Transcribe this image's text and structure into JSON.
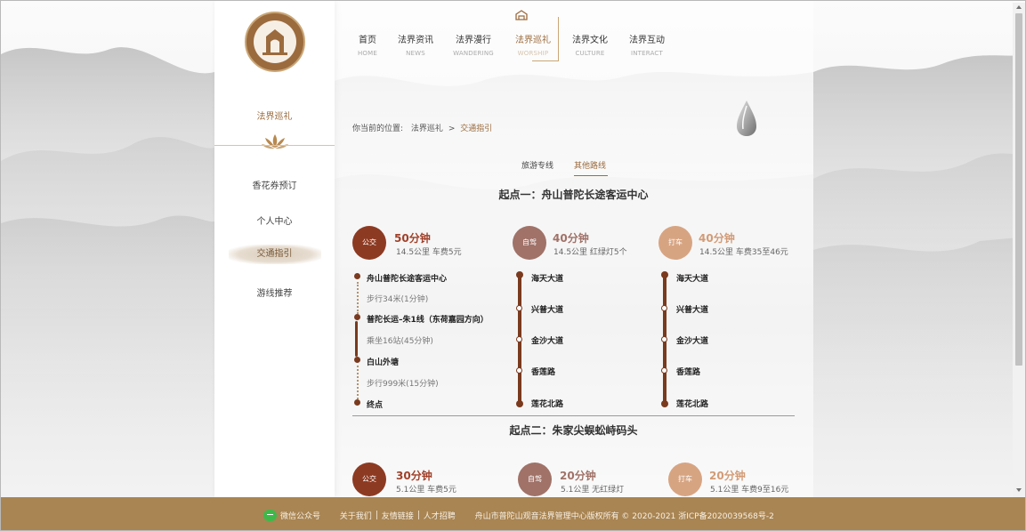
{
  "nav": [
    {
      "cn": "首页",
      "en": "HOME"
    },
    {
      "cn": "法界资讯",
      "en": "NEWS"
    },
    {
      "cn": "法界漫行",
      "en": "WANDERING"
    },
    {
      "cn": "法界巡礼",
      "en": "WORSHIP"
    },
    {
      "cn": "法界文化",
      "en": "CULTURE"
    },
    {
      "cn": "法界互动",
      "en": "INTERACT"
    }
  ],
  "nav_active_index": 3,
  "sidebar": {
    "title": "法界巡礼",
    "items": [
      {
        "label": "香花券预订"
      },
      {
        "label": "个人中心"
      },
      {
        "label": "交通指引"
      },
      {
        "label": "游线推荐"
      }
    ],
    "active_index": 2
  },
  "breadcrumb": {
    "prefix": "你当前的位置:",
    "parent": "法界巡礼",
    "sep": ">",
    "current": "交通指引"
  },
  "tabs": [
    {
      "label": "旅游专线"
    },
    {
      "label": "其他路线"
    }
  ],
  "active_tab": 1,
  "sections": [
    {
      "title": "起点一：舟山普陀长途客运中心",
      "routes": [
        {
          "badge": "公交",
          "time": "50分钟",
          "meta": "14.5公里 车费5元"
        },
        {
          "badge": "自驾",
          "time": "40分钟",
          "meta": "14.5公里 红绿灯5个"
        },
        {
          "badge": "打车",
          "time": "40分钟",
          "meta": "14.5公里 车费35至46元"
        }
      ],
      "bus_steps": [
        {
          "stop": "舟山普陀长途客运中心",
          "walk": "步行34米(1分钟)"
        },
        {
          "stop": "普陀长运–朱1线（东荷嘉园方向）",
          "walk": "乘坐16站(45分钟)"
        },
        {
          "stop": "白山外塘",
          "walk": "步行999米(15分钟)"
        },
        {
          "stop": "终点",
          "walk": ""
        }
      ],
      "drive_stops": [
        "海天大道",
        "兴普大道",
        "金沙大道",
        "香莲路",
        "莲花北路"
      ],
      "taxi_stops": [
        "海天大道",
        "兴普大道",
        "金沙大道",
        "香莲路",
        "莲花北路"
      ]
    },
    {
      "title": "起点二：朱家尖蜈蚣峙码头",
      "routes": [
        {
          "badge": "公交",
          "time": "30分钟",
          "meta": "5.1公里 车费5元"
        },
        {
          "badge": "自驾",
          "time": "20分钟",
          "meta": "5.1公里 无红绿灯"
        },
        {
          "badge": "打车",
          "time": "20分钟",
          "meta": "5.1公里 车费9至16元"
        }
      ]
    }
  ],
  "footer": {
    "wechat": "微信公众号",
    "links": [
      "关于我们",
      "友情链接",
      "人才招聘"
    ],
    "copyright": "舟山市普陀山观音法界管理中心版权所有 © 2020-2021 浙ICP备2020039568号-2"
  },
  "colors": {
    "accent": "#9b6b3e",
    "bus": "#8d3a22",
    "self_drive": "#a07268",
    "taxi": "#d7a482",
    "footer": "#a98553"
  },
  "icons": [
    "logo-emblem",
    "lotus-icon",
    "gate-icon",
    "water-drop-icon",
    "wechat-icon"
  ]
}
